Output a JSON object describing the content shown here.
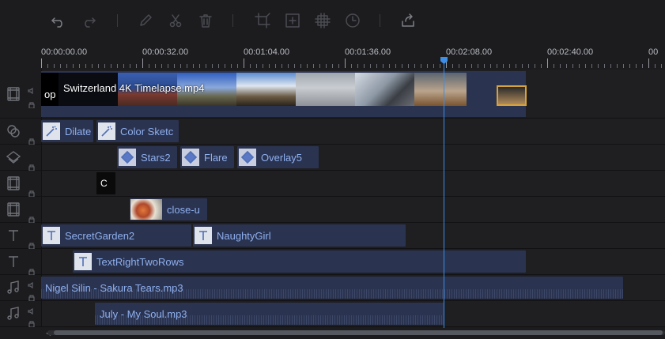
{
  "toolbar": {
    "buttons": [
      "undo-icon",
      "redo-icon",
      "edit-icon",
      "cut-icon",
      "delete-icon",
      "crop-icon",
      "freeze-frame-icon",
      "split-screen-icon",
      "duration-icon",
      "export-icon"
    ]
  },
  "ruler": {
    "labels": [
      "00:00:00.00",
      "00:00:32.00",
      "00:01:04.00",
      "00:01:36.00",
      "00:02:08.00",
      "00:02:40.00",
      "00"
    ]
  },
  "tracks": {
    "video_main": {
      "title": "Switzerland 4K  Timelapse.mp4",
      "prefix": "op"
    },
    "effects": [
      {
        "label": "Dilate"
      },
      {
        "label": "Color Sketc"
      }
    ],
    "overlays": [
      {
        "label": "Stars2"
      },
      {
        "label": "Flare"
      },
      {
        "label": "Overlay5"
      }
    ],
    "pip1": {
      "label": "C"
    },
    "pip2": {
      "label": "close-u"
    },
    "text1": [
      {
        "label": "SecretGarden2"
      },
      {
        "label": "NaughtyGirl"
      }
    ],
    "text2": [
      {
        "label": "TextRightTwoRows"
      }
    ],
    "audio1": {
      "label": "Nigel Silin - Sakura Tears.mp3"
    },
    "audio2": {
      "label": "July - My Soul.mp3"
    }
  },
  "colors": {
    "accent": "#3d8ee8",
    "clip": "#2a3350",
    "clip_text": "#8fb0ef"
  }
}
